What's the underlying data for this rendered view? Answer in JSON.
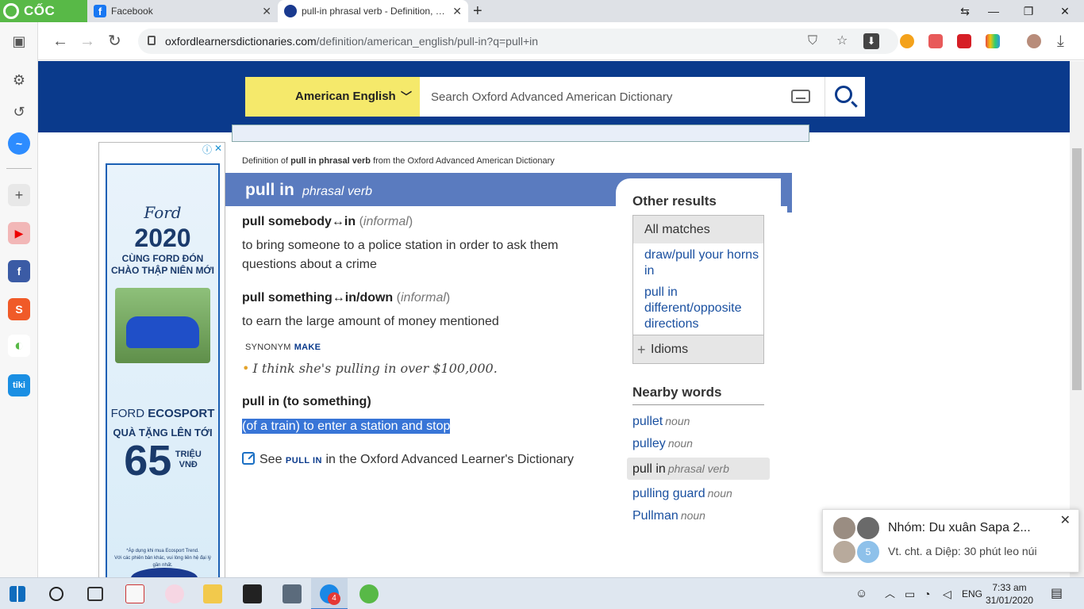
{
  "browser": {
    "brand": "CỐC CỐC",
    "tabs": [
      {
        "title": "Facebook",
        "favicon": "facebook-icon"
      },
      {
        "title": "pull-in phrasal verb - Definition, pictures, pronunciation",
        "favicon": "oxford-icon"
      }
    ],
    "url_host": "oxfordlearnersdictionaries.com",
    "url_path": "/definition/american_english/pull-in?q=pull+in"
  },
  "dictionary": {
    "selector_label": "American English",
    "search_placeholder": "Search Oxford Advanced American Dictionary"
  },
  "entry": {
    "crumb_prefix": "Definition of",
    "crumb_term": "pull in phrasal verb",
    "crumb_suffix": "from the Oxford Advanced American Dictionary",
    "headword": "pull in",
    "pos": "phrasal verb",
    "senses": [
      {
        "head": "pull somebody↔in",
        "label": "informal",
        "definition": "to bring someone to a police station in order to ask them questions about a crime"
      },
      {
        "head": "pull something↔in/down",
        "label": "informal",
        "definition": "to earn the large amount of money mentioned"
      },
      {
        "head": "pull in (to something)",
        "label": "",
        "definition": "(of a train) to enter a station and stop"
      }
    ],
    "synonym_label": "SYNONYM",
    "synonym_word": "MAKE",
    "example": "I think she's pulling in over $100,000.",
    "see_prefix": "See",
    "see_term": "PULL IN",
    "see_suffix": "in the Oxford Advanced Learner's Dictionary"
  },
  "other_results": {
    "title": "Other results",
    "all_matches": "All matches",
    "links": [
      "draw/pull your horns in",
      "pull in different/opposite directions"
    ],
    "idioms": "Idioms"
  },
  "nearby": {
    "title": "Nearby words",
    "items": [
      {
        "word": "pullet",
        "pos": "noun"
      },
      {
        "word": "pulley",
        "pos": "noun"
      },
      {
        "word": "pull in",
        "pos": "phrasal verb"
      },
      {
        "word": "pulling guard",
        "pos": "noun"
      },
      {
        "word": "Pullman",
        "pos": "noun"
      }
    ]
  },
  "ad": {
    "brand": "Ford",
    "year": "2020",
    "tagline_1": "CÙNG FORD ĐÓN",
    "tagline_2": "CHÀO THẬP NIÊN MỚI",
    "model_a": "FORD",
    "model_b": "ECOSPORT",
    "gift": "QUÀ TẶNG LÊN TỚI",
    "number": "65",
    "unit_1": "TRIỆU",
    "unit_2": "VNĐ",
    "fine_1": "*Áp dụng khi mua Ecosport Trend.",
    "fine_2": "Với các phiên bản khác, vui lòng liên hệ đại lý gần nhất."
  },
  "notification": {
    "title": "Nhóm: Du xuân Sapa 2...",
    "message": "Vt. cht. a Diệp: 30 phút leo núi",
    "member_count": "5"
  },
  "taskbar": {
    "zalo_badge": "4",
    "language": "ENG",
    "time": "7:33 am",
    "date": "31/01/2020"
  },
  "colors": {
    "header_blue": "#0a3a8c",
    "selector_yellow": "#f5e96b",
    "headword_bar": "#5a7bbf",
    "link_blue": "#1a50a0",
    "selection": "#3875d7"
  }
}
